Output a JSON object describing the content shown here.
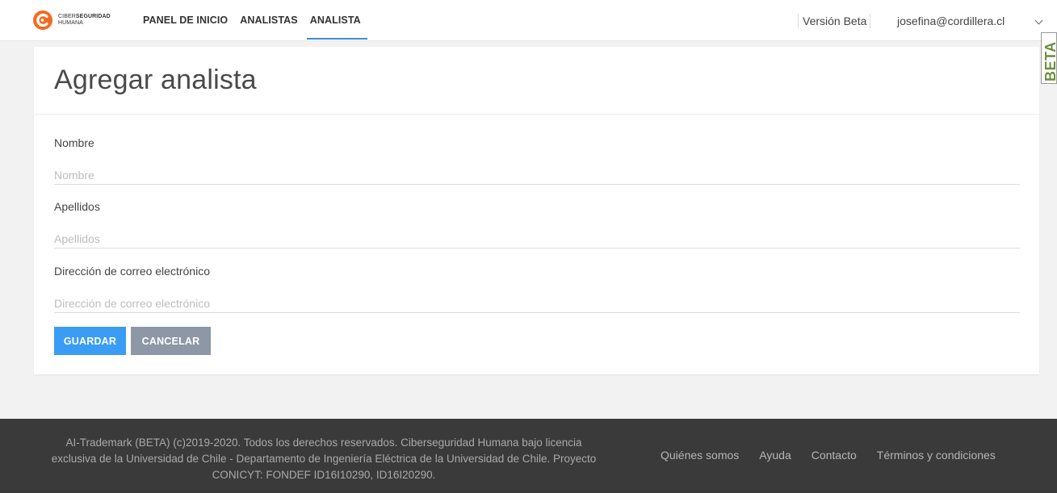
{
  "header": {
    "logo_line1_light": "CIBER",
    "logo_line1_bold": "SEGURIDAD",
    "logo_line2": "HUMANA",
    "nav": [
      {
        "label": "PANEL DE INICIO"
      },
      {
        "label": "ANALISTAS"
      },
      {
        "label": "ANALISTA"
      }
    ],
    "active_nav": "ANALISTA",
    "version": "Versión Beta",
    "user_email": "josefina@cordillera.cl",
    "side_tab": "BETA",
    "accent_color": "#3a8fd8"
  },
  "form": {
    "title": "Agregar analista",
    "fields": [
      {
        "label": "Nombre",
        "placeholder": "Nombre",
        "value": ""
      },
      {
        "label": "Apellidos",
        "placeholder": "Apellidos",
        "value": ""
      },
      {
        "label": "Dirección de correo electrónico",
        "placeholder": "Dirección de correo electrónico",
        "value": ""
      }
    ],
    "save_label": "GUARDAR",
    "cancel_label": "CANCELAR",
    "save_color": "#3b9cf4",
    "cancel_color": "#8d97a5"
  },
  "footer": {
    "text_line1": "AI-Trademark (BETA) (c)2019-2020. Todos los derechos reservados. Ciberseguridad Humana bajo licencia",
    "text_line2": "exclusiva de la Universidad de Chile - Departamento de Ingeniería Eléctrica de la Universidad de Chile. Proyecto",
    "text_line3": "CONICYT: FONDEF ID16I10290, ID16I20290.",
    "links": [
      "Quiénes somos",
      "Ayuda",
      "Contacto",
      "Términos y condiciones"
    ]
  }
}
